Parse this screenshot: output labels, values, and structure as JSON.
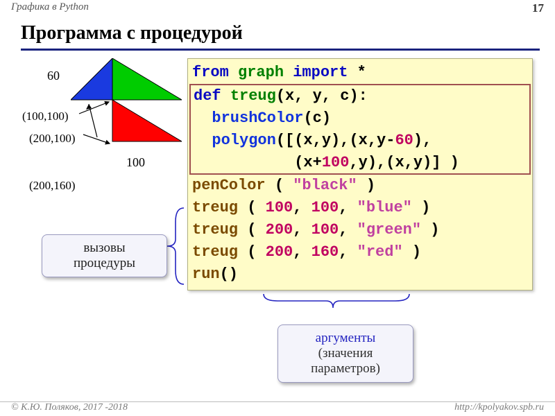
{
  "header": {
    "course": "Графика в Python",
    "page": "17"
  },
  "title": "Программа с процедурой",
  "illustration": {
    "side60": "60",
    "side100": "100",
    "p1": "(100,100)",
    "p2": "(200,100)",
    "p3": "(200,160)"
  },
  "code": {
    "l1_from": "from",
    "l1_mod": "graph",
    "l1_import": "import",
    "l1_star": "*",
    "l2_def": "def",
    "l2_name": "treug",
    "l2_params": "(x, y, c):",
    "l3_indent": "  ",
    "l3_fn": "brushColor",
    "l3_arg": "(c)",
    "l4_indent": "  ",
    "l4_fn": "polygon",
    "l4_a": "([(x,y),(x,y-",
    "l4_num": "60",
    "l4_b": "),",
    "l5_indent": "           ",
    "l5_a": "(x+",
    "l5_num": "100",
    "l5_b": ",y),(x,y)] )",
    "l6_fn": "penColor",
    "l6_open": " ( ",
    "l6_str": "\"black\"",
    "l6_close": " )",
    "l7_fn": "treug",
    "l7_open": " ( ",
    "l7_n1": "100",
    "l7_c1": ", ",
    "l7_n2": "100",
    "l7_c2": ", ",
    "l7_s": "\"blue\"",
    "l7_close": " )",
    "l8_fn": "treug",
    "l8_open": " ( ",
    "l8_n1": "200",
    "l8_c1": ", ",
    "l8_n2": "100",
    "l8_c2": ", ",
    "l8_s": "\"green\"",
    "l8_close": " )",
    "l9_fn": "treug",
    "l9_open": " ( ",
    "l9_n1": "200",
    "l9_c1": ", ",
    "l9_n2": "160",
    "l9_c2": ", ",
    "l9_s": "\"red\"",
    "l9_close": " )",
    "l10_fn": "run",
    "l10_paren": "()"
  },
  "callouts": {
    "calls_l1": "вызовы",
    "calls_l2": "процедуры",
    "args_l1": "аргументы",
    "args_l2": "(значения",
    "args_l3": "параметров)"
  },
  "footer": {
    "copyright": "© К.Ю. Поляков, 2017 -2018",
    "url": "http://kpolyakov.spb.ru"
  }
}
